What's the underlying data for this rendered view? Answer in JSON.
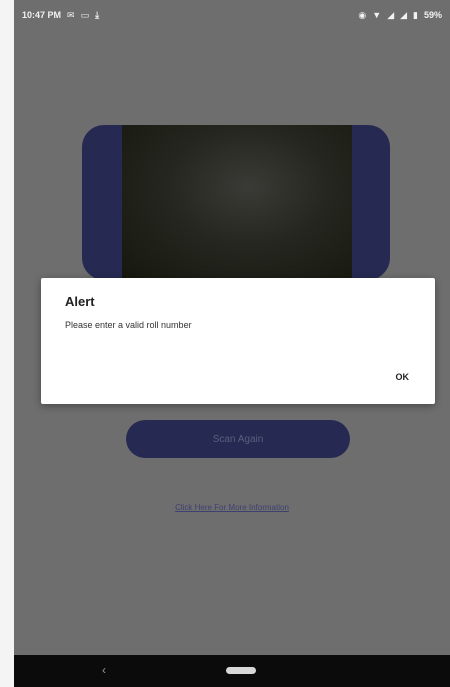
{
  "status_bar": {
    "time": "10:47 PM",
    "left_icons": [
      "notification-icon",
      "screen-icon",
      "download-icon"
    ],
    "battery": "59%",
    "right_icons": [
      "eye-icon",
      "wifi-icon",
      "signal-icon",
      "signal-icon",
      "battery-icon"
    ]
  },
  "scanner": {
    "frame_color": "#262a52"
  },
  "main": {
    "scan_again_label": "Scan Again",
    "info_link": "Click Here For More Information"
  },
  "alert": {
    "title": "Alert",
    "message": "Please enter a valid roll number",
    "ok_label": "OK"
  },
  "nav": {
    "back_icon": "back-chevron-icon",
    "home_icon": "home-pill-icon"
  }
}
